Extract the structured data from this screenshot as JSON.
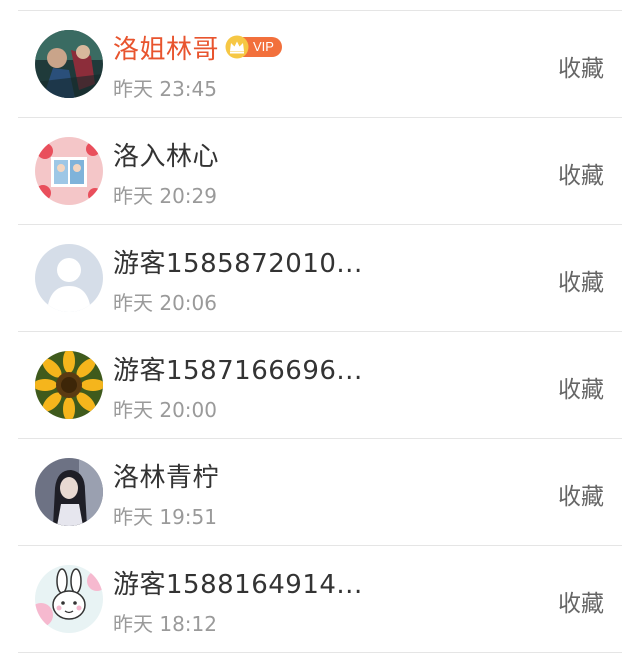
{
  "list": {
    "items": [
      {
        "name": "洛姐林哥",
        "time": "昨天 23:45",
        "action": "收藏",
        "vip": "VIP"
      },
      {
        "name": "洛入林心",
        "time": "昨天 20:29",
        "action": "收藏"
      },
      {
        "name": "游客1585872010...",
        "time": "昨天 20:06",
        "action": "收藏"
      },
      {
        "name": "游客1587166696...",
        "time": "昨天 20:00",
        "action": "收藏"
      },
      {
        "name": "洛林青柠",
        "time": "昨天 19:51",
        "action": "收藏"
      },
      {
        "name": "游客1588164914...",
        "time": "昨天 18:12",
        "action": "收藏"
      }
    ]
  },
  "colors": {
    "vip_name": "#e8542e",
    "vip_badge": "#f2703c",
    "name": "#333333",
    "time": "#9a9a9a",
    "action": "#666666",
    "divider": "#e5e5e5"
  }
}
